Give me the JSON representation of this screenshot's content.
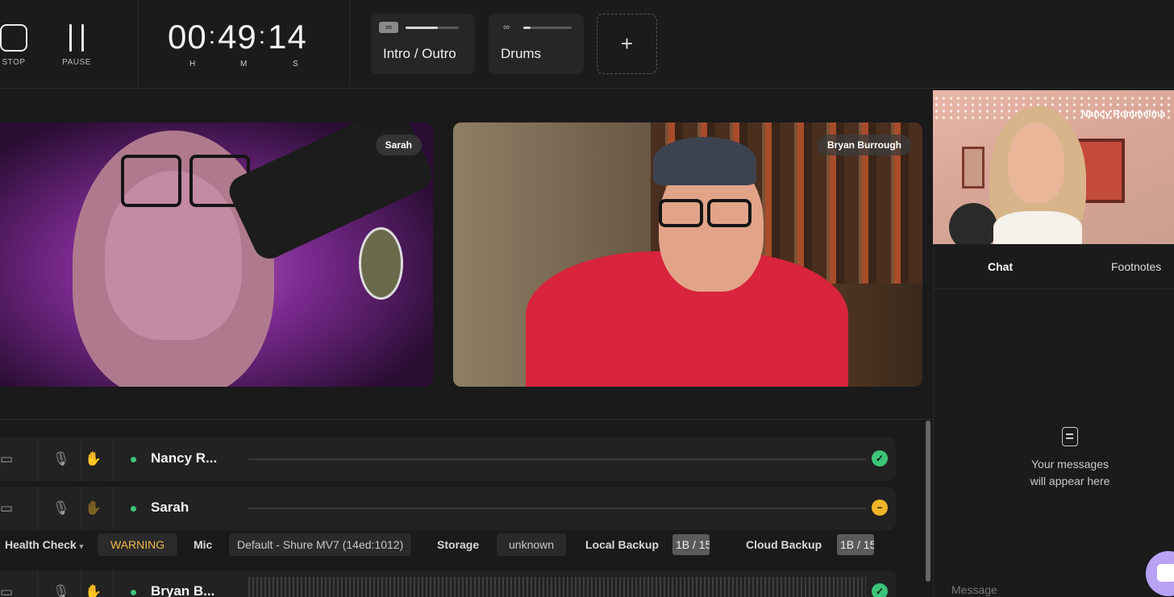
{
  "controls": {
    "stop_label": "STOP",
    "pause_label": "PAUSE"
  },
  "timer": {
    "hours": "00",
    "minutes": "49",
    "seconds": "14",
    "h_unit": "H",
    "m_unit": "M",
    "s_unit": "S"
  },
  "tracks": [
    {
      "name": "Intro / Outro",
      "loop_icon": "∞",
      "progress": 0.6
    },
    {
      "name": "Drums",
      "loop_icon": "∞",
      "progress": 0.15
    }
  ],
  "add_track_label": "+",
  "videos": {
    "sarah": {
      "name": "Sarah"
    },
    "bryan": {
      "name": "Bryan Burrough"
    },
    "nancy": {
      "name": "Nancy Rommelma"
    }
  },
  "sidebar": {
    "tabs": [
      "Chat",
      "Footnotes"
    ],
    "empty_line1": "Your messages",
    "empty_line2": "will appear here",
    "message_placeholder": "Message"
  },
  "participants": [
    {
      "name": "Nancy R...",
      "status": "ok"
    },
    {
      "name": "Sarah",
      "status": "warn"
    },
    {
      "name": "Bryan B...",
      "status": "ok"
    }
  ],
  "health": {
    "title": "Health Check",
    "state": "WARNING",
    "mic_label": "Mic",
    "mic_value": "Default - Shure MV7 (14ed:1012)",
    "storage_label": "Storage",
    "storage_value": "unknown",
    "local_label": "Local Backup",
    "local_value": "1B / 15.",
    "cloud_label": "Cloud Backup",
    "cloud_value": "1B / 15."
  },
  "colors": {
    "ok": "#3cc47a",
    "warn": "#f2b52a",
    "accent": "#b9a2f5"
  }
}
